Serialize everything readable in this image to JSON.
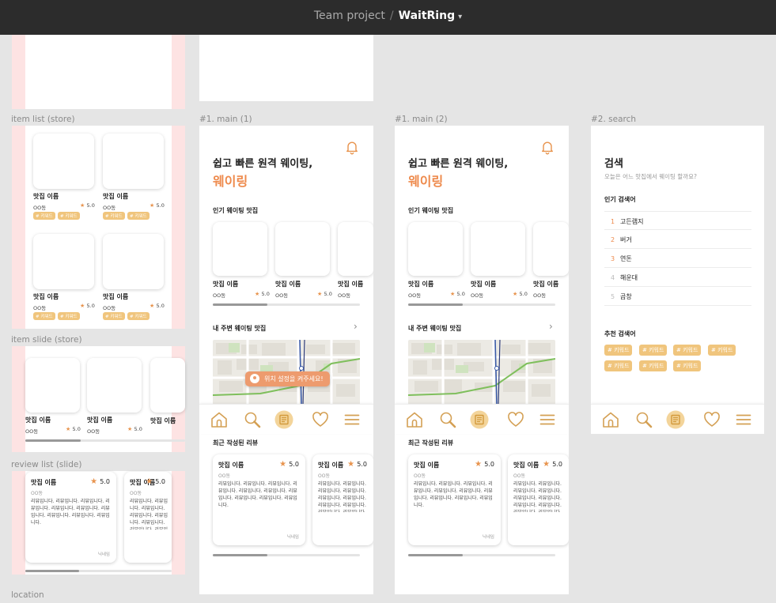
{
  "topbar": {
    "project": "Team project",
    "separator": "/",
    "file": "WaitRing"
  },
  "frames": {
    "item_list": "item list (store)",
    "item_slide": "item slide (store)",
    "review_list": "review list (slide)",
    "location": "location",
    "main1": "#1. main (1)",
    "main2": "#1. main (2)",
    "search": "#2. search"
  },
  "store": {
    "name": "맛집 이름",
    "area": "OO동",
    "rating": "5.0",
    "tag": "# 키워드"
  },
  "main": {
    "headline": "쉽고 빠른 원격 웨이팅,",
    "brand": "웨이링",
    "popular_title": "인기 웨이팅 맛집",
    "nearby_title": "내 주변 웨이팅 맛집",
    "location_prompt": "위치 설정을 켜주세요!",
    "recent_reviews_title": "최근 작성된 리뷰"
  },
  "review": {
    "title": "맛집 이름",
    "score": "5.0",
    "area": "OO동",
    "body": "리뷰입니다. 리뷰입니다. 리뷰입니다. 리뷰입니다. 리뷰입니다. 리뷰입니다. 리뷰입니다. 리뷰입니다. 리뷰입니다. 리뷰입니다.",
    "nickname": "닉네임"
  },
  "search": {
    "title": "검색",
    "subtitle": "오늘은 어느 맛집에서 웨이팅 할까요?",
    "popular_title": "인기 검색어",
    "popular": [
      {
        "rank": "1",
        "term": "고든램지"
      },
      {
        "rank": "2",
        "term": "버거"
      },
      {
        "rank": "3",
        "term": "연돈"
      },
      {
        "rank": "4",
        "term": "해운대"
      },
      {
        "rank": "5",
        "term": "곱창"
      }
    ],
    "recommend_title": "추천 검색어",
    "keywords": [
      "# 키워드",
      "# 키워드",
      "# 키워드",
      "# 키워드",
      "# 키워드",
      "# 키워드",
      "# 키워드"
    ]
  },
  "icons": {
    "nav": [
      "home-icon",
      "search-icon",
      "list-icon",
      "heart-icon",
      "menu-icon"
    ],
    "bell": "bell-icon",
    "star": "star-icon",
    "location": "location-pin-icon",
    "chevron": "chevron-right-icon"
  },
  "colors": {
    "accent": "#ee8a4c",
    "tag": "#f0c57d",
    "pill": "#ed9b6e",
    "nav_active": "#f3d49a"
  }
}
